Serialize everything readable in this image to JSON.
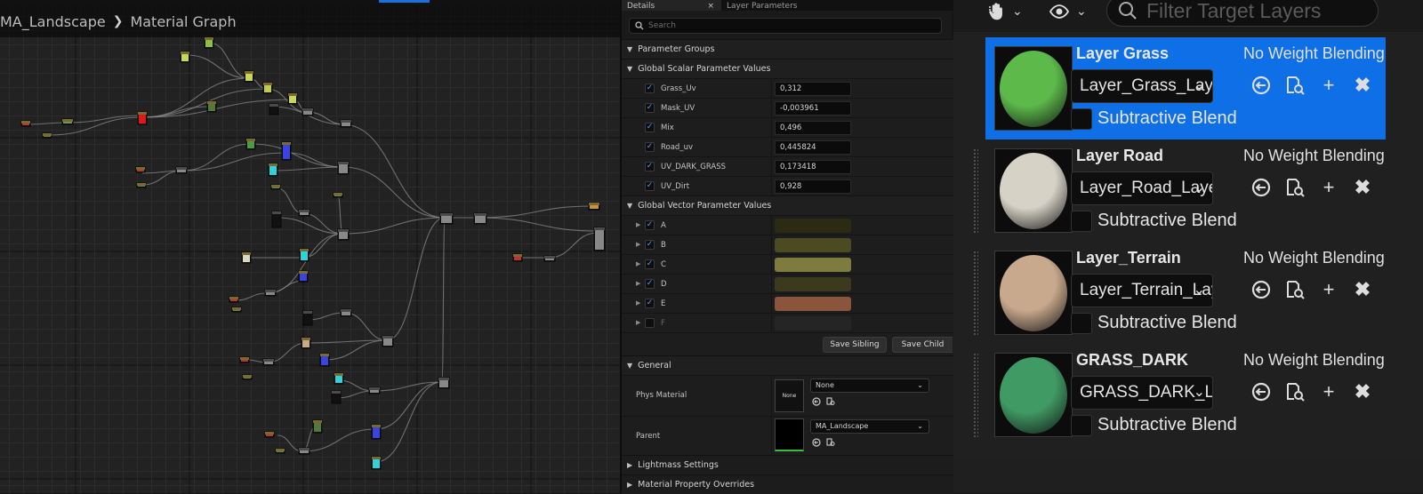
{
  "graph": {
    "breadcrumb": {
      "asset": "MA_Landscape",
      "view": "Material Graph"
    }
  },
  "details": {
    "tabs": [
      {
        "label": "Details",
        "active": true
      },
      {
        "label": "Layer Parameters",
        "active": false
      }
    ],
    "search_placeholder": "Search",
    "sections": {
      "parameter_groups": "Parameter Groups",
      "scalar": "Global Scalar Parameter Values",
      "vector": "Global Vector Parameter Values",
      "general": "General",
      "lightmass": "Lightmass Settings",
      "overrides": "Material Property Overrides"
    },
    "scalar_params": [
      {
        "name": "Grass_Uv",
        "value": "0,312",
        "checked": true
      },
      {
        "name": "Mask_UV",
        "value": "-0,003961",
        "checked": true
      },
      {
        "name": "Mix",
        "value": "0,496",
        "checked": true
      },
      {
        "name": "Road_uv",
        "value": "0,445824",
        "checked": true
      },
      {
        "name": "UV_DARK_GRASS",
        "value": "0,173418",
        "checked": true
      },
      {
        "name": "UV_Dirt",
        "value": "0,928",
        "checked": true
      }
    ],
    "vector_params": [
      {
        "name": "A",
        "color": "#2b2b14",
        "checked": true
      },
      {
        "name": "B",
        "color": "#4b4a20",
        "checked": true
      },
      {
        "name": "C",
        "color": "#7d7b3e",
        "checked": true
      },
      {
        "name": "D",
        "color": "#3c3a1c",
        "checked": true
      },
      {
        "name": "E",
        "color": "#8a553b",
        "checked": true
      },
      {
        "name": "F",
        "color": "#252525",
        "checked": false
      }
    ],
    "buttons": {
      "save_sibling": "Save Sibling",
      "save_child": "Save Child"
    },
    "general": {
      "phys_material_label": "Phys Material",
      "phys_material_thumb": "None",
      "phys_material_value": "None",
      "parent_label": "Parent",
      "parent_value": "MA_Landscape"
    }
  },
  "layers": {
    "filter_placeholder": "Filter Target Layers",
    "items": [
      {
        "name": "Layer Grass",
        "blend": "No Weight Blending",
        "asset": "Layer_Grass_Layer",
        "subtractive": "Subtractive Blend",
        "selected": true,
        "sphere": "#5cb94a"
      },
      {
        "name": "Layer Road",
        "blend": "No Weight Blending",
        "asset": "Layer_Road_Layerlı",
        "subtractive": "Subtractive Blend",
        "selected": false,
        "sphere": "#d6d2c6"
      },
      {
        "name": "Layer_Terrain",
        "blend": "No Weight Blending",
        "asset": "Layer_Terrain_Laye",
        "subtractive": "Subtractive Blend",
        "selected": false,
        "sphere": "#c9a98d"
      },
      {
        "name": "GRASS_DARK",
        "blend": "No Weight Blending",
        "asset": "GRASS_DARK_Laye",
        "subtractive": "Subtractive Blend",
        "selected": false,
        "sphere": "#3f9a63"
      }
    ]
  },
  "colors": {
    "accent": "#0f6fe6",
    "panel_bg": "#1a1a1a",
    "graph_bg": "#222222"
  }
}
